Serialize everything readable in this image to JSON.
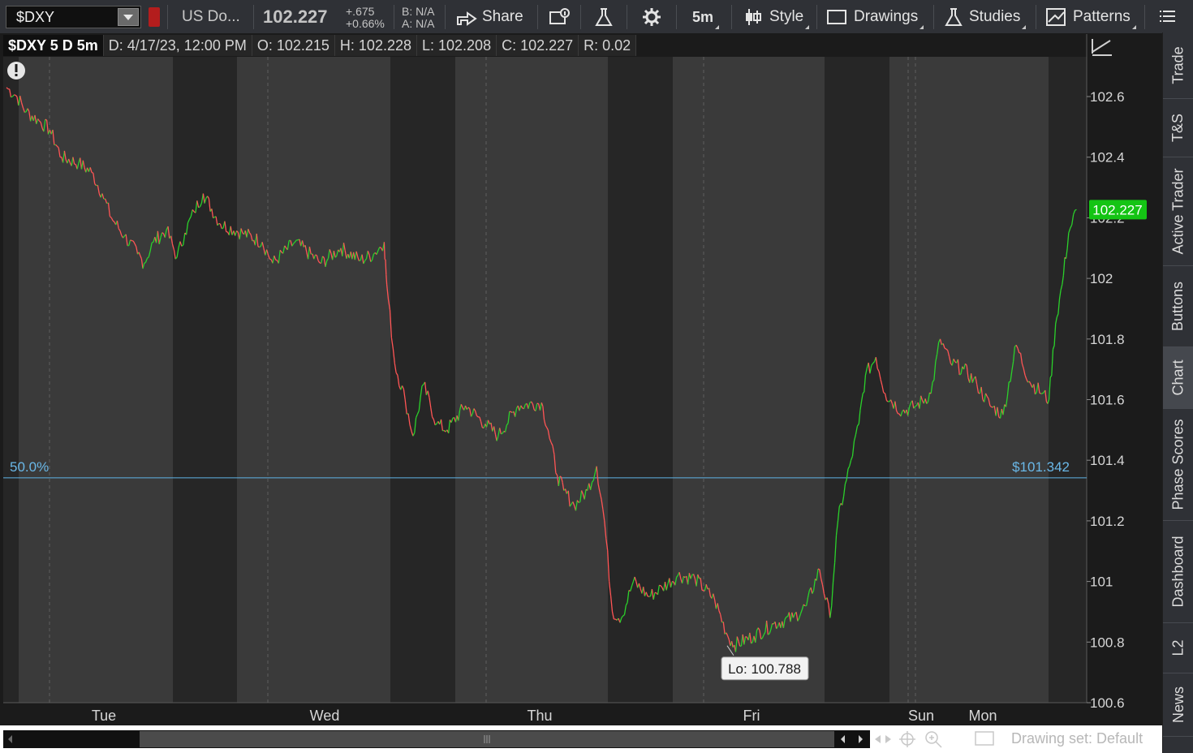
{
  "toolbar": {
    "symbol": "$DXY",
    "description": "US Do...",
    "last_price": "102.227",
    "net_change": "+.675",
    "pct_change": "+0.66%",
    "bid": "B: N/A",
    "ask": "A: N/A",
    "share_label": "Share",
    "timeframe_label": "5m",
    "style_label": "Style",
    "drawings_label": "Drawings",
    "studies_label": "Studies",
    "patterns_label": "Patterns"
  },
  "header": {
    "symbol_period": "$DXY 5 D 5m",
    "date": "D: 4/17/23, 12:00 PM",
    "open": "O: 102.215",
    "high": "H: 102.228",
    "low": "L: 102.208",
    "close": "C: 102.227",
    "range": "R: 0.02"
  },
  "chart_data": {
    "type": "line",
    "price_ticks": [
      "102.6",
      "102.4",
      "102.2",
      "102",
      "101.8",
      "101.6",
      "101.4",
      "101.2",
      "101",
      "100.8",
      "100.6"
    ],
    "day_labels": [
      "Tue",
      "Wed",
      "Thu",
      "Fri",
      "Sun",
      "Mon"
    ],
    "ylim": [
      100.6,
      102.7
    ],
    "fib_level": {
      "left_label": "50.0%",
      "right_label": "$101.342",
      "value": 101.342
    },
    "low_marker": {
      "label": "Lo: 100.788",
      "value": 100.788
    },
    "current_price": {
      "label": "102.227",
      "value": 102.227
    },
    "series": [
      {
        "points": [
          [
            0,
            102.63
          ],
          [
            0.8,
            102.6
          ],
          [
            1.5,
            102.55
          ],
          [
            2.5,
            102.52
          ],
          [
            3.3,
            102.49
          ],
          [
            4.2,
            102.4
          ],
          [
            5.5,
            102.38
          ],
          [
            6.5,
            102.35
          ],
          [
            7.3,
            102.28
          ],
          [
            8,
            102.2
          ],
          [
            9,
            102.14
          ],
          [
            10,
            102.08
          ],
          [
            10.5,
            102.05
          ],
          [
            11.2,
            102.12
          ],
          [
            12.2,
            102.16
          ],
          [
            13,
            102.07
          ],
          [
            13.6,
            102.15
          ],
          [
            14.3,
            102.22
          ],
          [
            15,
            102.28
          ],
          [
            16.3,
            102.18
          ],
          [
            18,
            102.15
          ],
          [
            19.5,
            102.12
          ],
          [
            20.3,
            102.05
          ],
          [
            22,
            102.12
          ],
          [
            24,
            102.05
          ],
          [
            25.5,
            102.1
          ],
          [
            27,
            102.06
          ],
          [
            28,
            102.08
          ],
          [
            28.8,
            102.12
          ],
          [
            29,
            101.98
          ],
          [
            29.6,
            101.72
          ],
          [
            30.4,
            101.6
          ],
          [
            31,
            101.48
          ],
          [
            31.8,
            101.65
          ],
          [
            32.8,
            101.52
          ],
          [
            33.6,
            101.5
          ],
          [
            35,
            101.58
          ],
          [
            36.5,
            101.52
          ],
          [
            37.5,
            101.48
          ],
          [
            39,
            101.58
          ],
          [
            40.8,
            101.59
          ],
          [
            41.3,
            101.5
          ],
          [
            42,
            101.35
          ],
          [
            42.5,
            101.3
          ],
          [
            43.3,
            101.25
          ],
          [
            44.3,
            101.3
          ],
          [
            45,
            101.38
          ],
          [
            45.6,
            101.2
          ],
          [
            46.2,
            100.9
          ],
          [
            46.9,
            100.88
          ],
          [
            47.8,
            101.0
          ],
          [
            49,
            100.95
          ],
          [
            50,
            100.98
          ],
          [
            51.2,
            101.02
          ],
          [
            52.5,
            101.01
          ],
          [
            54,
            100.94
          ],
          [
            55,
            100.82
          ],
          [
            55.5,
            100.79
          ],
          [
            57,
            100.82
          ],
          [
            58.5,
            100.86
          ],
          [
            60,
            100.88
          ],
          [
            61,
            100.92
          ],
          [
            62,
            101.04
          ],
          [
            62.8,
            100.88
          ],
          [
            63.4,
            101.2
          ],
          [
            64.4,
            101.4
          ],
          [
            65,
            101.52
          ],
          [
            65.5,
            101.68
          ],
          [
            66.3,
            101.74
          ],
          [
            67,
            101.62
          ],
          [
            68.3,
            101.56
          ],
          [
            69.4,
            101.58
          ],
          [
            70.5,
            101.62
          ],
          [
            71.2,
            101.8
          ],
          [
            72,
            101.72
          ],
          [
            73,
            101.7
          ],
          [
            74,
            101.65
          ],
          [
            75,
            101.58
          ],
          [
            76,
            101.55
          ],
          [
            77,
            101.78
          ],
          [
            78,
            101.66
          ],
          [
            79,
            101.62
          ],
          [
            79.5,
            101.6
          ],
          [
            80,
            101.85
          ],
          [
            80.5,
            101.98
          ],
          [
            81,
            102.15
          ],
          [
            81.6,
            102.227
          ]
        ]
      }
    ]
  },
  "side_tabs": [
    "Trade",
    "T&S",
    "Active Trader",
    "Buttons",
    "Chart",
    "Phase Scores",
    "Dashboard",
    "L2",
    "News"
  ],
  "status": {
    "drawing_set": "Drawing set: Default"
  }
}
